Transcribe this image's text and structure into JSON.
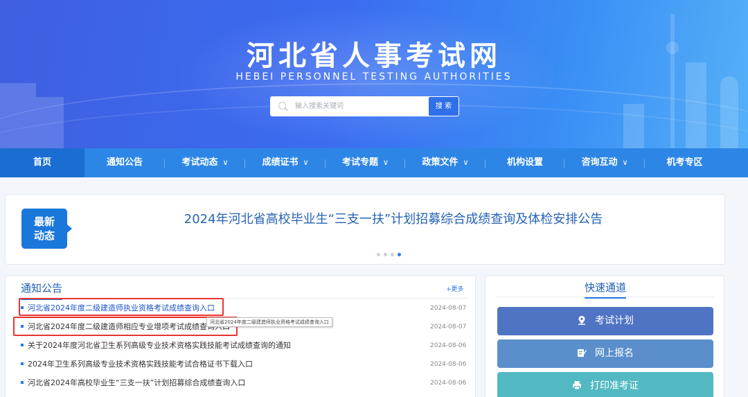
{
  "header": {
    "title": "河北省人事考试网",
    "subtitle": "HEBEI PERSONNEL TESTING AUTHORITIES",
    "search_placeholder": "输入搜索关键词",
    "search_button": "搜 索"
  },
  "nav": {
    "items": [
      {
        "label": "首页",
        "active": true,
        "dropdown": false
      },
      {
        "label": "通知公告",
        "active": false,
        "dropdown": false
      },
      {
        "label": "考试动态",
        "active": false,
        "dropdown": true
      },
      {
        "label": "成绩证书",
        "active": false,
        "dropdown": true
      },
      {
        "label": "考试专题",
        "active": false,
        "dropdown": true
      },
      {
        "label": "政策文件",
        "active": false,
        "dropdown": true
      },
      {
        "label": "机构设置",
        "active": false,
        "dropdown": false
      },
      {
        "label": "咨询互动",
        "active": false,
        "dropdown": true
      },
      {
        "label": "机考专区",
        "active": false,
        "dropdown": false
      }
    ]
  },
  "banner": {
    "badge_line1": "最新",
    "badge_line2": "动态",
    "headline": "2024年河北省高校毕业生“三支一扶”计划招募综合成绩查询及体检安排公告",
    "slide_count": 4,
    "active_slide": 4
  },
  "notice": {
    "title": "通知公告",
    "more": "+更多",
    "rows": [
      {
        "text": "河北省2024年度二级建造师执业资格考试成绩查询入口",
        "date": "2024-08-07"
      },
      {
        "text": "河北省2024年度二级建造师相应专业增项考试成绩查询入口",
        "date": "2024-08-07"
      },
      {
        "text": "关于2024年度河北省卫生系列高级专业技术资格实践技能考试成绩查询的通知",
        "date": "2024-08-06"
      },
      {
        "text": "2024年卫生系列高级专业技术资格实践技能考试合格证书下载入口",
        "date": "2024-08-06"
      },
      {
        "text": "河北省2024年高校毕业生“三支一扶”计划招募综合成绩查询入口",
        "date": "2024-08-06"
      }
    ],
    "tooltip": "河北省2024年度二级建造师执业资格考试成绩查询入口"
  },
  "quick": {
    "title": "快速通道",
    "buttons": [
      {
        "label": "考试计划",
        "icon": "location-pin-icon",
        "color": "#4f74c4"
      },
      {
        "label": "网上报名",
        "icon": "edit-form-icon",
        "color": "#5a8fcb"
      },
      {
        "label": "打印准考证",
        "icon": "printer-icon",
        "color": "#52b9c2"
      }
    ]
  },
  "colors": {
    "nav_bg": "#2d86e6",
    "nav_active": "#1b6ed1",
    "accent": "#2a7ae0",
    "highlight_box": "#e8352f"
  }
}
